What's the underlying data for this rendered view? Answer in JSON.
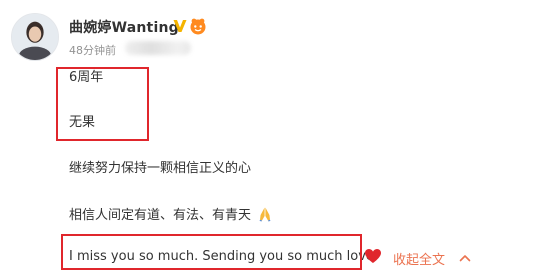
{
  "post": {
    "author": "曲婉婷Wanting",
    "timestamp": "48分钟前",
    "lines": [
      "6周年",
      "无果",
      "继续努力保持一颗相信正义的心",
      "相信人间定有道、有法、有青天",
      "I miss you so much. Sending you so much love"
    ],
    "collapse_label": "收起全文"
  },
  "icons": {
    "verified": "verified-v-badge-icon",
    "vip": "vip-member-badge-icon",
    "pray": "folded-hands-emoji",
    "heart": "red-heart-emoji",
    "collapse": "chevron-up-icon"
  },
  "colors": {
    "accent_orange": "#eb7350",
    "highlight_red": "#e0262c",
    "verified_gold": "#f5b400"
  }
}
